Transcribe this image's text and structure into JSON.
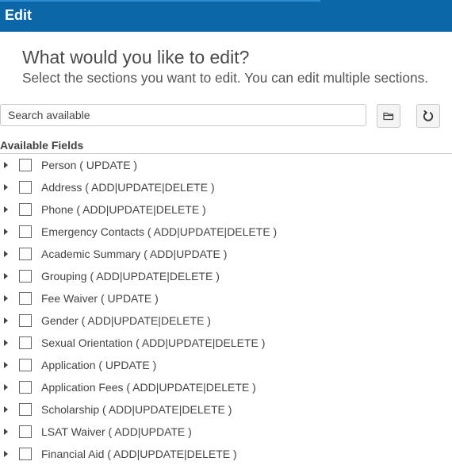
{
  "header": {
    "title": "Edit",
    "color": "#0b67a7"
  },
  "intro": {
    "heading": "What would you like to edit?",
    "subheading": "Select the sections you want to edit. You can edit multiple sections."
  },
  "search": {
    "placeholder": "Search available",
    "value": ""
  },
  "toolbar": {
    "folder_icon": "folder-icon",
    "refresh_icon": "refresh-icon"
  },
  "fields": {
    "title": "Available Fields",
    "items": [
      {
        "label": "Person ( UPDATE )",
        "checked": false
      },
      {
        "label": "Address ( ADD|UPDATE|DELETE )",
        "checked": false
      },
      {
        "label": "Phone ( ADD|UPDATE|DELETE )",
        "checked": false
      },
      {
        "label": "Emergency Contacts ( ADD|UPDATE|DELETE )",
        "checked": false
      },
      {
        "label": "Academic Summary ( ADD|UPDATE )",
        "checked": false
      },
      {
        "label": "Grouping ( ADD|UPDATE|DELETE )",
        "checked": false
      },
      {
        "label": "Fee Waiver ( UPDATE )",
        "checked": false
      },
      {
        "label": "Gender ( ADD|UPDATE|DELETE )",
        "checked": false
      },
      {
        "label": "Sexual Orientation ( ADD|UPDATE|DELETE )",
        "checked": false
      },
      {
        "label": "Application ( UPDATE )",
        "checked": false
      },
      {
        "label": "Application Fees ( ADD|UPDATE|DELETE )",
        "checked": false
      },
      {
        "label": "Scholarship ( ADD|UPDATE|DELETE )",
        "checked": false
      },
      {
        "label": "LSAT Waiver ( ADD|UPDATE )",
        "checked": false
      },
      {
        "label": "Financial Aid ( ADD|UPDATE|DELETE )",
        "checked": false
      }
    ]
  }
}
